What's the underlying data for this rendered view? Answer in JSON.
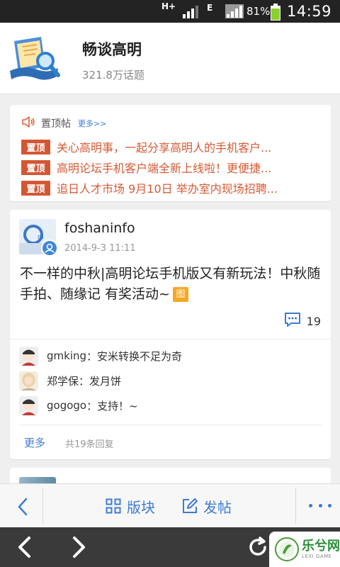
{
  "status_bar": {
    "network_hplus": "H+",
    "network_e": "E",
    "battery_percent": "81%",
    "time": "14:59"
  },
  "header": {
    "title": "畅谈高明",
    "topic_count": "321.8万话题"
  },
  "pinned": {
    "label": "置顶帖",
    "more_label": "更多>>",
    "tag_label": "置顶",
    "items": [
      {
        "text": "关心高明事，一起分享高明人的手机客户..."
      },
      {
        "text": "高明论坛手机客户端全新上线啦！更便捷..."
      },
      {
        "text": "追日人才市场 9月10日 举办室内现场招聘..."
      }
    ]
  },
  "post": {
    "author": "foshaninfo",
    "time": "2014-9-3 11:11",
    "title": "不一样的中秋|高明论坛手机版又有新玩法！中秋随手拍、随缘记 有奖活动~",
    "image_badge": "图",
    "comment_count": "19",
    "replies": [
      {
        "user": "gmking",
        "separator": "：",
        "text": "安米转换不足为奇"
      },
      {
        "user": "郑学保",
        "separator": "：",
        "text": "发月饼"
      },
      {
        "user": "gogogo",
        "separator": "：",
        "text": "支持！~"
      }
    ],
    "more_label": "更多",
    "total_replies": "共19条回复"
  },
  "toolbar": {
    "forums_label": "版块",
    "post_label": "发帖"
  },
  "watermark": {
    "main": "乐兮网",
    "sub": "LEXI GAME"
  },
  "colors": {
    "accent_blue": "#3d7bd5",
    "pin_red": "#d45734",
    "pin_text": "#d65a34",
    "image_badge": "#f4a824"
  }
}
